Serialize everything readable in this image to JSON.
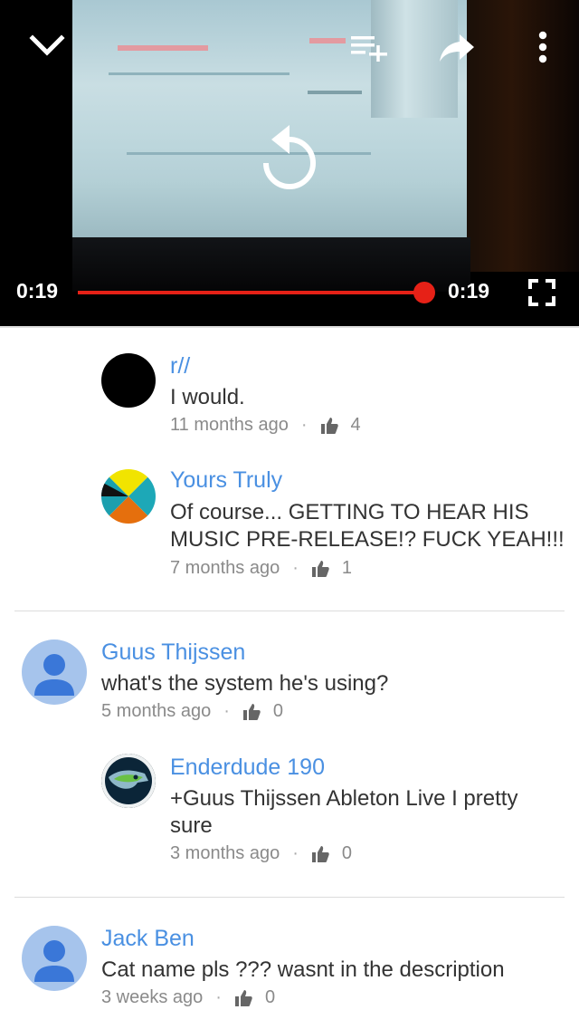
{
  "player": {
    "current_time": "0:19",
    "duration": "0:19",
    "progress": 1.0,
    "accent_color": "#e62117"
  },
  "icons": {
    "collapse": "chevron-down-icon",
    "add_to_playlist": "playlist-add-icon",
    "share": "share-icon",
    "more": "more-vert-icon",
    "replay": "replay-icon",
    "fullscreen": "fullscreen-icon",
    "like": "thumb-up-icon"
  },
  "comments": [
    {
      "author": "r//",
      "text": "I would.",
      "time": "11 months ago",
      "likes": "4"
    },
    {
      "author": "Yours Truly",
      "text": "Of course... GETTING TO HEAR HIS MUSIC PRE-RELEASE!? FUCK YEAH!!!",
      "time": "7 months ago",
      "likes": "1"
    },
    {
      "author": "Guus Thijssen",
      "text": "what's the system he's using?",
      "time": "5 months ago",
      "likes": "0"
    },
    {
      "author": "Enderdude 190",
      "text": "+Guus Thijssen Ableton Live I pretty sure",
      "time": "3 months ago",
      "likes": "0"
    },
    {
      "author": "Jack Ben",
      "text": "Cat name pls ??? wasnt in the description",
      "time": "3 weeks ago",
      "likes": "0"
    }
  ],
  "separator": "·"
}
